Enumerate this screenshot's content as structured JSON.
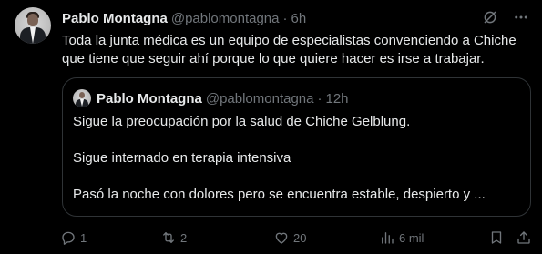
{
  "tweet": {
    "author_name": "Pablo Montagna",
    "handle": "@pablomontagna",
    "separator": "·",
    "time": "6h",
    "text": "Toda la junta médica es un equipo de especialistas convenciendo a Chiche que tiene que seguir ahí porque lo que quiere hacer es irse a trabajar."
  },
  "quoted_tweet": {
    "author_name": "Pablo Montagna",
    "handle": "@pablomontagna",
    "separator": "·",
    "time": "12h",
    "paragraphs": [
      "Sigue la preocupación por la salud de Chiche Gelblung.",
      "Sigue internado en terapia intensiva",
      "Pasó la noche con dolores pero se encuentra estable, despierto y ..."
    ]
  },
  "actions": {
    "replies": "1",
    "retweets": "2",
    "likes": "20",
    "views": "6 mil"
  },
  "icons": {
    "grok": "grok-icon",
    "more": "more-icon",
    "reply": "reply-icon",
    "retweet": "retweet-icon",
    "like": "heart-icon",
    "views": "views-icon",
    "bookmark": "bookmark-icon",
    "share": "share-icon"
  },
  "colors": {
    "background": "#000000",
    "text": "#e7e9ea",
    "muted": "#71767b",
    "border": "#2f3336"
  }
}
